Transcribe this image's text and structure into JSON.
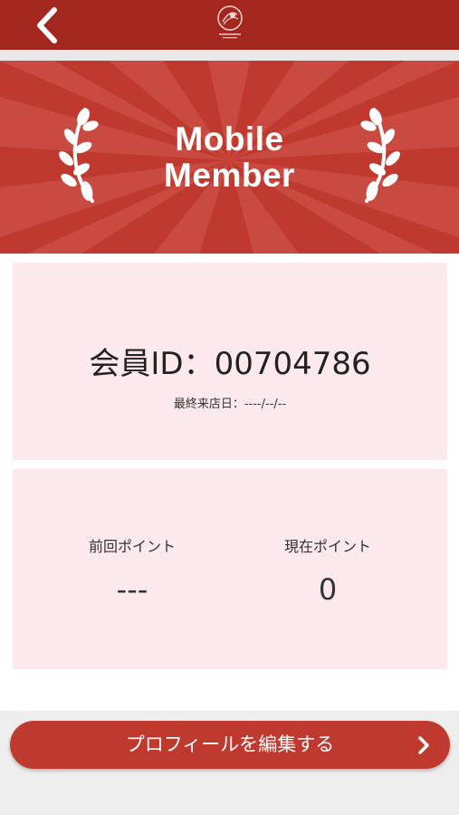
{
  "header": {
    "back_icon": "chevron-left-icon",
    "logo_icon": "restaurant-logo-icon",
    "logo_text": "SESERAGI"
  },
  "banner": {
    "title_line1": "Mobile",
    "title_line2": "Member",
    "decoration_icon": "laurel-icon"
  },
  "member": {
    "id_label": "会員ID：00704786",
    "last_visit": "最終来店日：----/--/--"
  },
  "points": {
    "previous_label": "前回ポイント",
    "previous_value": "---",
    "current_label": "現在ポイント",
    "current_value": "0"
  },
  "actions": {
    "edit_profile_label": "プロフィールを編集する",
    "edit_profile_icon": "chevron-right-icon"
  },
  "colors": {
    "header_bg": "#a3271f",
    "accent_red": "#c0392f",
    "card_bg": "#fbe9ec"
  }
}
